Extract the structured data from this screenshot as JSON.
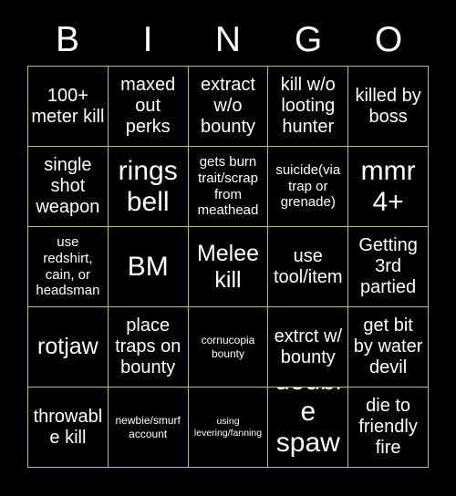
{
  "card": {
    "title": "BINGO",
    "header_letters": [
      "B",
      "I",
      "N",
      "G",
      "O"
    ],
    "grid_size": 5,
    "colors": {
      "background": "#000000",
      "grid_line": "#b9c63e",
      "text": "#ffffff"
    },
    "cells": [
      {
        "text": "100+ meter kill",
        "size": "md"
      },
      {
        "text": "maxed out perks",
        "size": "md"
      },
      {
        "text": "extract w/o bounty",
        "size": "md"
      },
      {
        "text": "kill w/o looting hunter",
        "size": "md"
      },
      {
        "text": "killed by boss",
        "size": "md"
      },
      {
        "text": "single shot weapon",
        "size": "md"
      },
      {
        "text": "rings bell",
        "size": "xl"
      },
      {
        "text": "gets burn trait/scrap from meathead",
        "size": "sm"
      },
      {
        "text": "suicide(via trap or grenade)",
        "size": "sm"
      },
      {
        "text": "mmr 4+",
        "size": "xl"
      },
      {
        "text": "use redshirt, cain, or headsman",
        "size": "sm"
      },
      {
        "text": "BM",
        "size": "xl"
      },
      {
        "text": "Melee kill",
        "size": "lg"
      },
      {
        "text": "use tool/item",
        "size": "md"
      },
      {
        "text": "Getting 3rd partied",
        "size": "md"
      },
      {
        "text": "rotjaw",
        "size": "lg"
      },
      {
        "text": "place traps on bounty",
        "size": "md"
      },
      {
        "text": "cornucopia bounty",
        "size": "xs"
      },
      {
        "text": "extrct w/ bounty",
        "size": "md"
      },
      {
        "text": "get bit by water devil",
        "size": "md"
      },
      {
        "text": "throwable kill",
        "size": "md"
      },
      {
        "text": "newbie/smurf account",
        "size": "xs"
      },
      {
        "text": "using levering/fanning",
        "size": "xxs"
      },
      {
        "text": "double spawn",
        "size": "xl"
      },
      {
        "text": "die to friendly fire",
        "size": "md"
      }
    ]
  }
}
